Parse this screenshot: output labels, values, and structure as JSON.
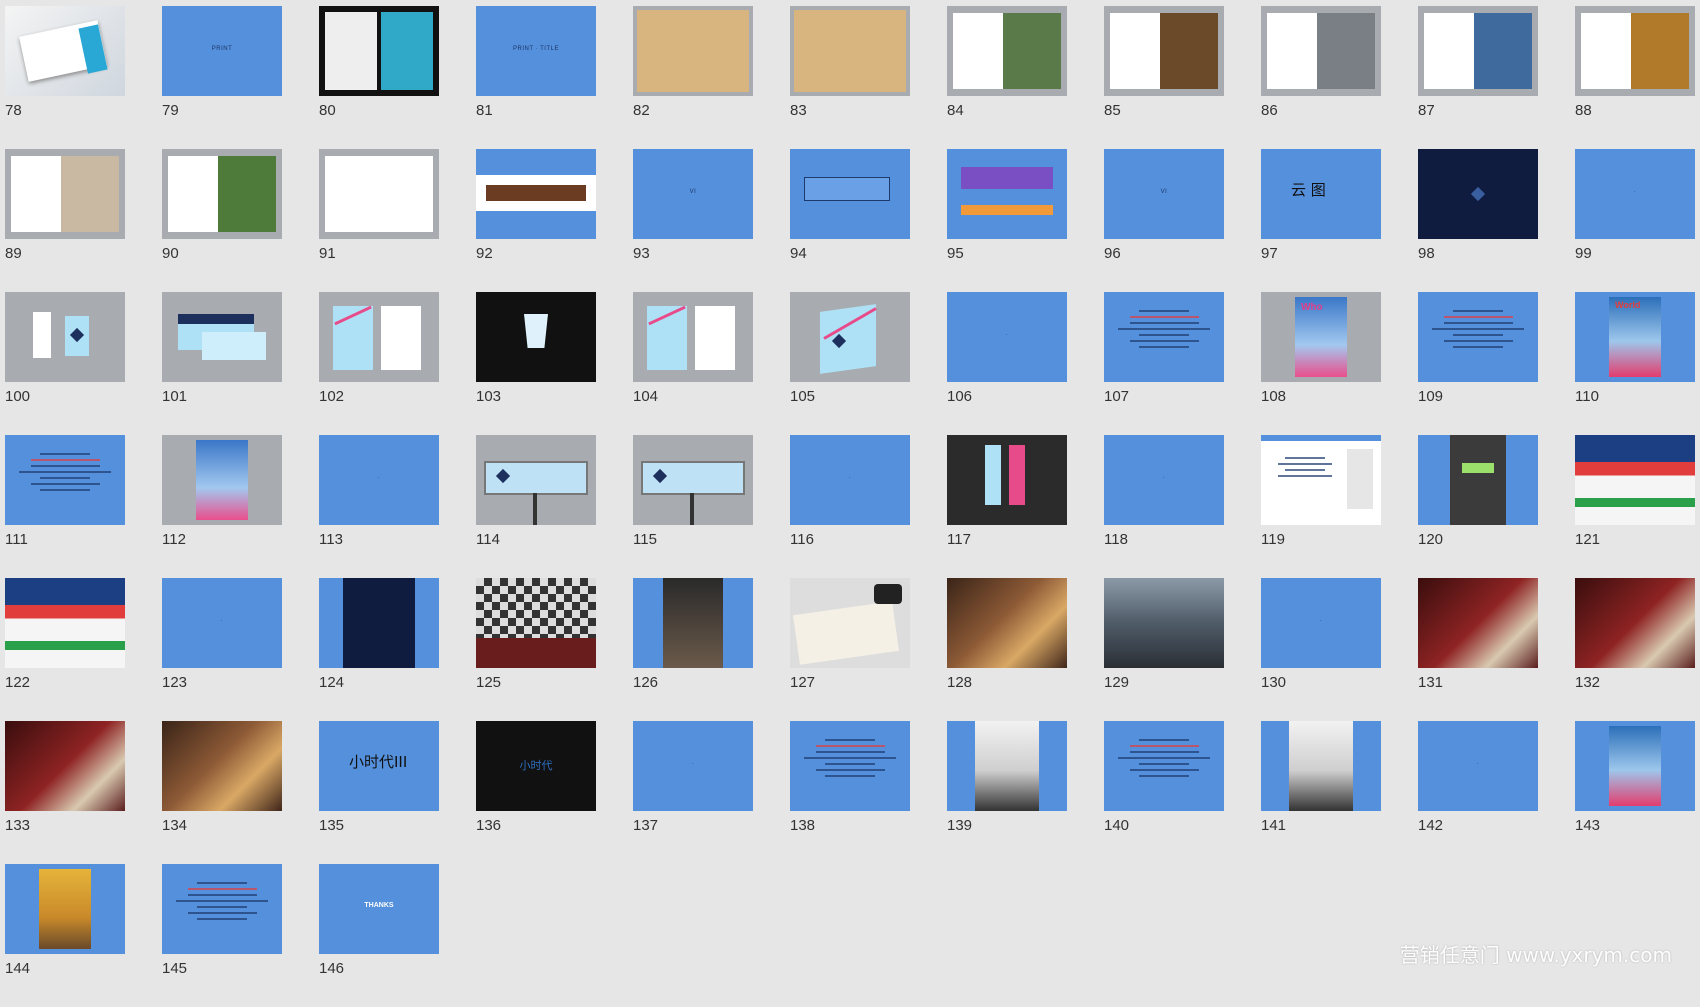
{
  "slides": [
    {
      "num": "78",
      "kind": "magazine"
    },
    {
      "num": "79",
      "kind": "blue-title",
      "text": "PRINT"
    },
    {
      "num": "80",
      "kind": "magazine-dark"
    },
    {
      "num": "81",
      "kind": "blue-title",
      "text": "PRINT · TITLE"
    },
    {
      "num": "82",
      "kind": "kraft"
    },
    {
      "num": "83",
      "kind": "kraft"
    },
    {
      "num": "84",
      "kind": "book-photo",
      "tone": "#5b7a4a"
    },
    {
      "num": "85",
      "kind": "book-photo",
      "tone": "#6b4a2a"
    },
    {
      "num": "86",
      "kind": "book-photo",
      "tone": "#7a7f86"
    },
    {
      "num": "87",
      "kind": "book-photo",
      "tone": "#3e6a9e"
    },
    {
      "num": "88",
      "kind": "book-photo",
      "tone": "#b07a2a"
    },
    {
      "num": "89",
      "kind": "book-photo",
      "tone": "#c9b9a3"
    },
    {
      "num": "90",
      "kind": "book-photo",
      "tone": "#4e7a3a"
    },
    {
      "num": "91",
      "kind": "book-blank"
    },
    {
      "num": "92",
      "kind": "leather"
    },
    {
      "num": "93",
      "kind": "blue-title",
      "text": "VI"
    },
    {
      "num": "94",
      "kind": "blue-box"
    },
    {
      "num": "95",
      "kind": "blue-box-color"
    },
    {
      "num": "96",
      "kind": "blue-title",
      "text": "VI"
    },
    {
      "num": "97",
      "kind": "cn-logo",
      "text": "云 图"
    },
    {
      "num": "98",
      "kind": "navy"
    },
    {
      "num": "99",
      "kind": "blue-title",
      "text": "·"
    },
    {
      "num": "100",
      "kind": "grey-cards"
    },
    {
      "num": "101",
      "kind": "grey-envelope"
    },
    {
      "num": "102",
      "kind": "grey-folders"
    },
    {
      "num": "103",
      "kind": "dark-cup"
    },
    {
      "num": "104",
      "kind": "grey-folders"
    },
    {
      "num": "105",
      "kind": "grey-bag"
    },
    {
      "num": "106",
      "kind": "blue-title",
      "text": "·"
    },
    {
      "num": "107",
      "kind": "blue-lines"
    },
    {
      "num": "108",
      "kind": "grey-poster",
      "text": "Who"
    },
    {
      "num": "109",
      "kind": "blue-lines"
    },
    {
      "num": "110",
      "kind": "blue-poster",
      "text": "World"
    },
    {
      "num": "111",
      "kind": "blue-lines"
    },
    {
      "num": "112",
      "kind": "grey-poster",
      "text": ""
    },
    {
      "num": "113",
      "kind": "blue-title",
      "text": "·"
    },
    {
      "num": "114",
      "kind": "billboard"
    },
    {
      "num": "115",
      "kind": "billboard"
    },
    {
      "num": "116",
      "kind": "blue-title",
      "text": "·"
    },
    {
      "num": "117",
      "kind": "dark-banners"
    },
    {
      "num": "118",
      "kind": "blue-title",
      "text": "·"
    },
    {
      "num": "119",
      "kind": "web"
    },
    {
      "num": "120",
      "kind": "phone"
    },
    {
      "num": "121",
      "kind": "web-ad"
    },
    {
      "num": "122",
      "kind": "web-ad"
    },
    {
      "num": "123",
      "kind": "blue-title",
      "text": "·"
    },
    {
      "num": "124",
      "kind": "blue-navy-strip"
    },
    {
      "num": "125",
      "kind": "interior-checker"
    },
    {
      "num": "126",
      "kind": "blue-photo-center"
    },
    {
      "num": "127",
      "kind": "book-camera"
    },
    {
      "num": "128",
      "kind": "warm-photo"
    },
    {
      "num": "129",
      "kind": "city-photo"
    },
    {
      "num": "130",
      "kind": "blue-title",
      "text": "·"
    },
    {
      "num": "131",
      "kind": "red-photo"
    },
    {
      "num": "132",
      "kind": "red-photo"
    },
    {
      "num": "133",
      "kind": "red-photo"
    },
    {
      "num": "134",
      "kind": "warm-photo"
    },
    {
      "num": "135",
      "kind": "cn-logo",
      "text": "小时代III"
    },
    {
      "num": "136",
      "kind": "dark-cn",
      "text": "小时代"
    },
    {
      "num": "137",
      "kind": "blue-title",
      "text": "·"
    },
    {
      "num": "138",
      "kind": "blue-lines"
    },
    {
      "num": "139",
      "kind": "blue-person"
    },
    {
      "num": "140",
      "kind": "blue-lines"
    },
    {
      "num": "141",
      "kind": "blue-person"
    },
    {
      "num": "142",
      "kind": "blue-title",
      "text": "·"
    },
    {
      "num": "143",
      "kind": "blue-poster",
      "text": ""
    },
    {
      "num": "144",
      "kind": "blue-yellow-poster"
    },
    {
      "num": "145",
      "kind": "blue-lines"
    },
    {
      "num": "146",
      "kind": "thanks",
      "text": "THANKS"
    }
  ],
  "watermark": "营销任意门 www.yxrym.com",
  "colors": {
    "background": "#e6e6e6",
    "slide_blue": "#5590dc",
    "navy": "#0f1c3f"
  }
}
